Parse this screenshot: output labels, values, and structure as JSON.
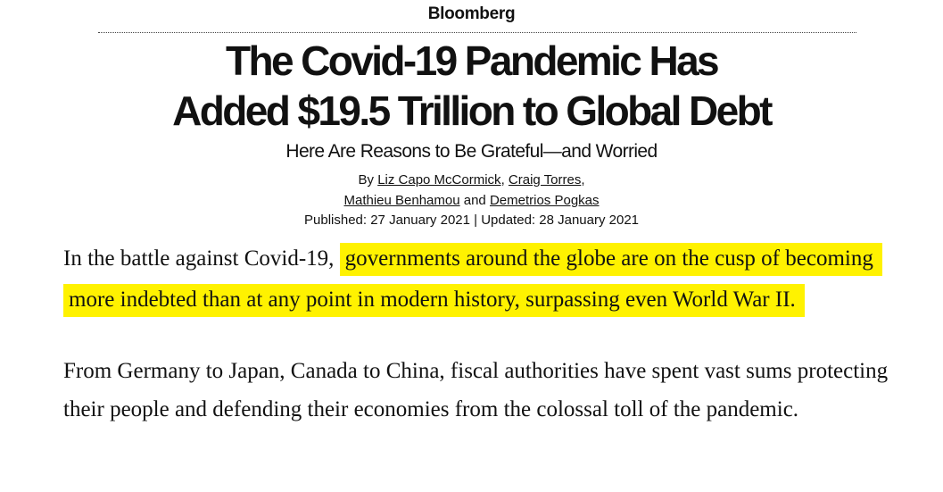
{
  "masthead": {
    "brand": "Bloomberg"
  },
  "article": {
    "headline_line1": "The Covid-19 Pandemic Has",
    "headline_line2": "Added $19.5 Trillion to Global Debt",
    "subhead": "Here Are Reasons to Be Grateful—and Worried",
    "byline": {
      "prefix": "By",
      "author1": "Liz Capo McCormick",
      "sep1": ",",
      "author2": "Craig Torres",
      "sep2": ",",
      "author3": "Mathieu Benhamou",
      "conj": "and",
      "author4": "Demetrios Pogkas"
    },
    "dates": "Published: 27 January 2021 | Updated: 28 January 2021",
    "paragraph1": {
      "lead": "In the battle against Covid-19, ",
      "highlighted": "governments around the globe are on the cusp of becoming more indebted than at any point in modern history, surpassing even World War II."
    },
    "paragraph2": "From Germany to Japan, Canada to China, fiscal authorities have spent vast sums protecting their people and defending their economies from the colossal toll of the pandemic."
  },
  "colors": {
    "highlight": "#fff200",
    "text": "#111111",
    "background": "#ffffff"
  }
}
